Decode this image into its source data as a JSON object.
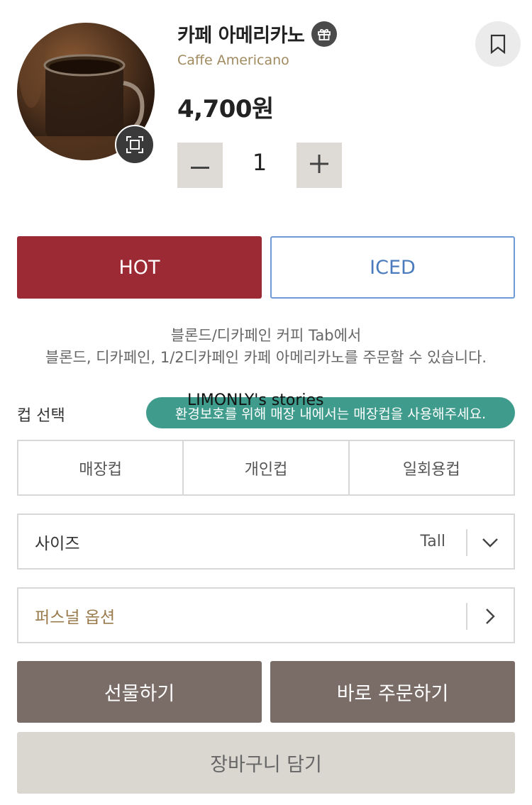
{
  "product": {
    "name_ko": "카페 아메리카노",
    "name_en": "Caffe Americano",
    "price": "4,700원",
    "quantity": "1"
  },
  "icons": {
    "gift": "gift-icon",
    "bookmark": "bookmark-icon",
    "zoom": "zoom-icon",
    "minus": "minus-icon",
    "plus": "plus-icon",
    "size_dropdown": "chevron-down-icon",
    "options_arrow": "chevron-right-icon"
  },
  "temperature": {
    "hot_label": "HOT",
    "iced_label": "ICED",
    "selected": "HOT"
  },
  "notice": {
    "line1": "블론드/디카페인 커피 Tab에서",
    "line2": "블론드, 디카페인, 1/2디카페인 카페 아메리카노를 주문할 수 있습니다."
  },
  "cup": {
    "label": "컵 선택",
    "tooltip": "환경보호를 위해 매장 내에서는 매장컵을 사용해주세요.",
    "options": [
      "매장컵",
      "개인컵",
      "일회용컵"
    ]
  },
  "watermark": "LIMONLY's stories",
  "size": {
    "label": "사이즈",
    "value": "Tall"
  },
  "personal_option": {
    "label": "퍼스널 옵션"
  },
  "actions": {
    "gift": "선물하기",
    "order": "바로 주문하기",
    "cart": "장바구니 담기"
  },
  "colors": {
    "hot": "#9b2a35",
    "iced": "#4a7bbd",
    "tooltip": "#3f9b8c",
    "action": "#7a6c66",
    "cart": "#dad7d1",
    "gold": "#a08a5f"
  }
}
